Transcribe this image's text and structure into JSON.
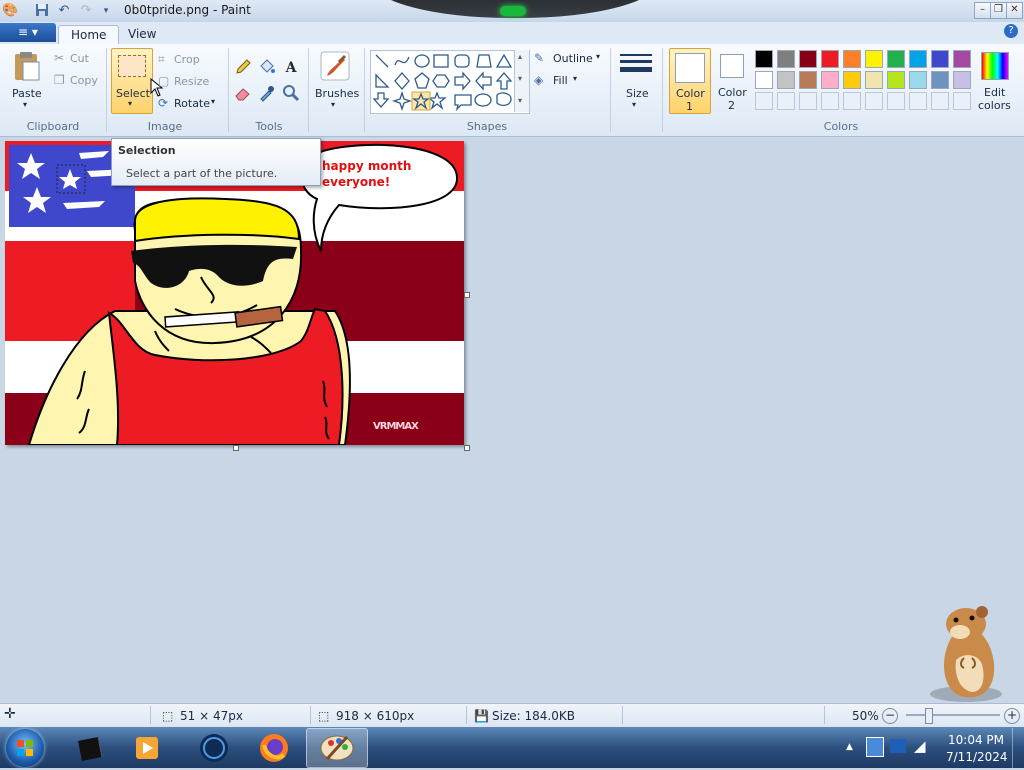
{
  "window": {
    "title": "0b0tpride.png - Paint"
  },
  "tabs": {
    "file_glyph": "≡ ▾",
    "home": "Home",
    "view": "View"
  },
  "clipboard": {
    "paste": "Paste",
    "cut": "Cut",
    "copy": "Copy",
    "label": "Clipboard"
  },
  "image": {
    "select": "Select",
    "crop": "Crop",
    "resize": "Resize",
    "rotate": "Rotate",
    "label": "Image"
  },
  "tools": {
    "label": "Tools"
  },
  "brushes": {
    "label": "Brushes"
  },
  "shapes": {
    "outline": "Outline",
    "fill": "Fill",
    "label": "Shapes"
  },
  "size": {
    "label": "Size"
  },
  "colors": {
    "color1_line1": "Color",
    "color1_line2": "1",
    "color2_line1": "Color",
    "color2_line2": "2",
    "edit_line1": "Edit",
    "edit_line2": "colors",
    "label": "Colors",
    "row1": [
      "#000000",
      "#7f7f7f",
      "#880015",
      "#ed1c24",
      "#ff7f27",
      "#fff200",
      "#22b14c",
      "#00a2e8",
      "#3f48cc",
      "#a349a4"
    ],
    "row2": [
      "#ffffff",
      "#c3c3c3",
      "#b97a57",
      "#ffaec9",
      "#ffc90e",
      "#efe4b0",
      "#b5e61d",
      "#99d9ea",
      "#7092be",
      "#c8bfe7"
    ]
  },
  "tooltip": {
    "title": "Selection",
    "description": "Select a part of the picture."
  },
  "canvas_art": {
    "speech": "happy month everyone!",
    "speech_line1": "happy month",
    "speech_line2": "everyone!",
    "signature": "VRMMAX"
  },
  "status": {
    "selection_size": "51 × 47px",
    "image_size": "918 × 610px",
    "file_size": "Size: 184.0KB",
    "zoom": "50%"
  },
  "taskbar": {
    "time": "10:04 PM",
    "date": "7/11/2024"
  }
}
